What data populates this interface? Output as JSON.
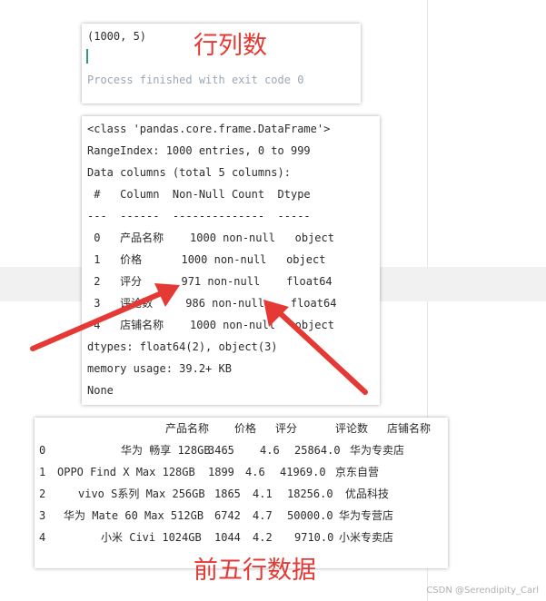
{
  "panel1": {
    "shape": "(1000, 5)",
    "process": "Process finished with exit code 0",
    "title": "行列数"
  },
  "panel2": {
    "lines": [
      "<class 'pandas.core.frame.DataFrame'>",
      "RangeIndex: 1000 entries, 0 to 999",
      "Data columns (total 5 columns):",
      " #   Column  Non-Null Count  Dtype",
      "---  ------  --------------  -----",
      " 0   产品名称    1000 non-null   object",
      " 1   价格      1000 non-null   object",
      " 2   评分      971 non-null    float64",
      " 3   评论数     986 non-null    float64",
      " 4   店铺名称    1000 non-null   object",
      "dtypes: float64(2), object(3)",
      "memory usage: 39.2+ KB",
      "None"
    ]
  },
  "panel3": {
    "headers": [
      "产品名称",
      "价格",
      "评分",
      "评论数",
      "店铺名称"
    ],
    "rows": [
      [
        "0",
        "华为 畅享 128GB",
        "3465",
        "4.6",
        "25864.0",
        "华为专卖店"
      ],
      [
        "1",
        "OPPO Find X Max 128GB",
        "1899",
        "4.6",
        "41969.0",
        "京东自营"
      ],
      [
        "2",
        "vivo S系列 Max 256GB",
        "1865",
        "4.1",
        "18256.0",
        "优品科技"
      ],
      [
        "3",
        "华为 Mate 60 Max 512GB",
        "6742",
        "4.7",
        "50000.0",
        "华为专营店"
      ],
      [
        "4",
        "小米 Civi 1024GB",
        "1044",
        "4.2",
        "9710.0",
        "小米专卖店"
      ]
    ],
    "title": "前五行数据"
  },
  "footer": "CSDN @Serendipity_Carl",
  "colors": {
    "accent_red": "#e53935",
    "cursor_green": "#2e9e6a"
  }
}
